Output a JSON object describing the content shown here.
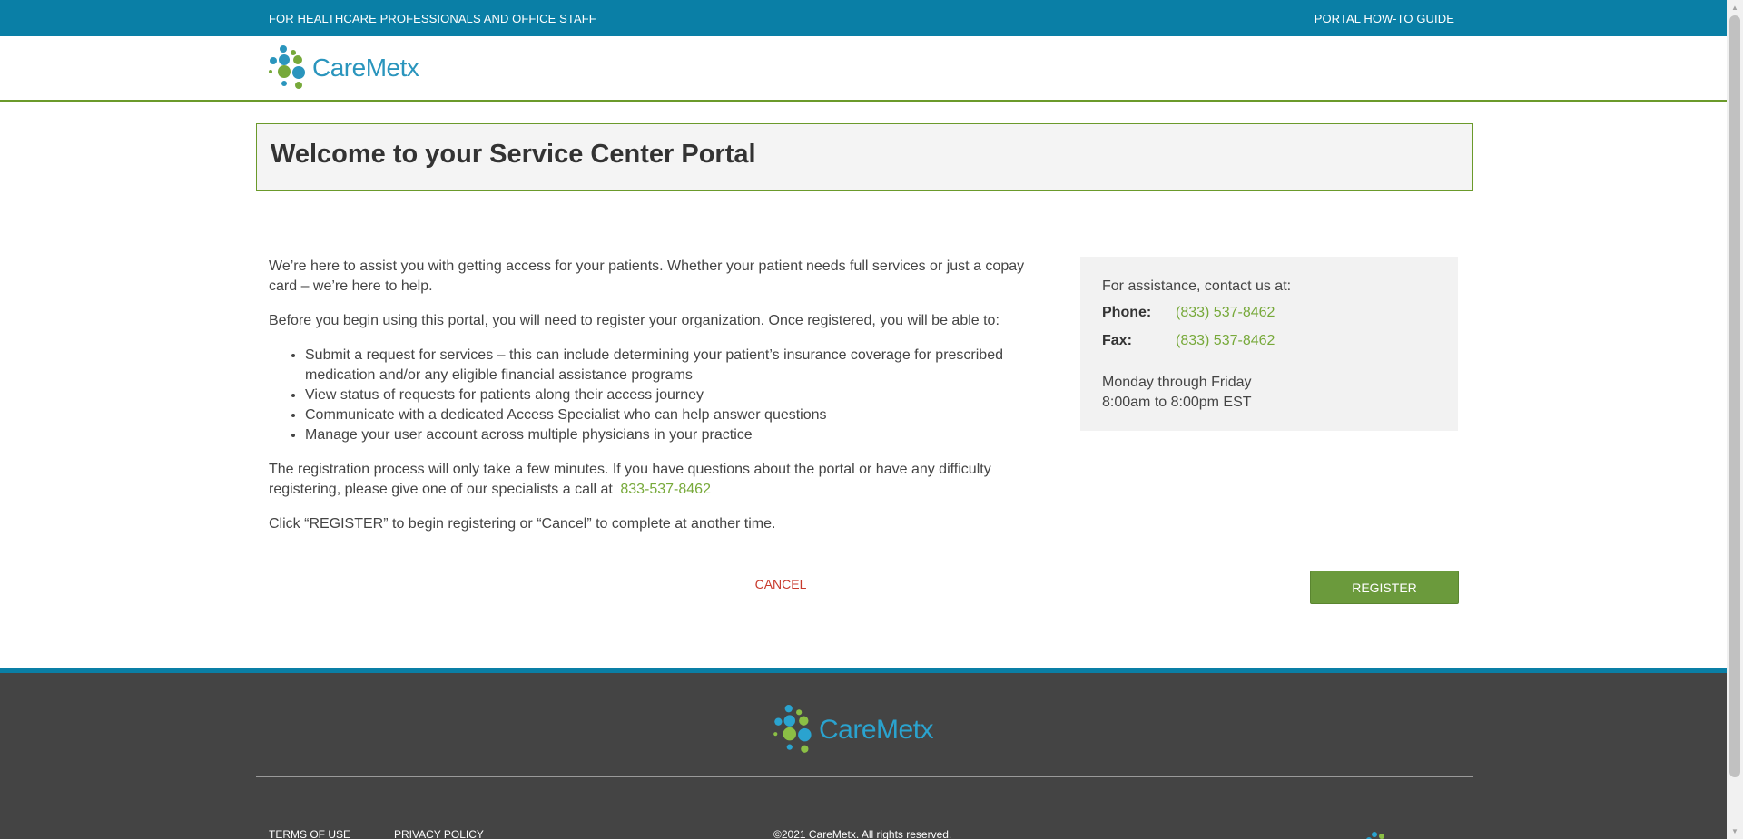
{
  "topbar": {
    "audience": "FOR HEALTHCARE PROFESSIONALS AND OFFICE STAFF",
    "guide_link": "PORTAL HOW-TO GUIDE"
  },
  "brand": {
    "logo_text": "CareMetx",
    "colors": {
      "teal": "#0a7fa6",
      "green": "#6b9a3c",
      "dark": "#444444"
    }
  },
  "welcome": {
    "title": "Welcome to your Service Center Portal"
  },
  "intro": {
    "p1": "We’re here to assist you with getting access for your patients. Whether your patient needs full services or just a copay card – we’re here to help.",
    "p2": "Before you begin using this portal, you will need to register your organization. Once registered, you will be able to:",
    "bullets": [
      "Submit a request for services – this can include determining your patient’s insurance coverage for prescribed medication and/or any eligible financial assistance programs",
      "View status of requests for patients along their access journey",
      "Communicate with a dedicated Access Specialist who can help answer questions",
      "Manage your user account across multiple physicians in your practice"
    ],
    "p3": "The registration process will only take a few minutes. If you have questions about the portal or have any difficulty registering, please give one of our specialists a call at",
    "p3_phone": "833-537-8462",
    "p4": "Click “REGISTER” to begin registering or “Cancel” to complete at another time."
  },
  "contact": {
    "heading": "For assistance, contact us at:",
    "phone_label": "Phone:",
    "phone": "(833) 537-8462",
    "fax_label": "Fax:",
    "fax": "(833) 537-8462",
    "days": "Monday through Friday",
    "hours": "8:00am to 8:00pm EST"
  },
  "actions": {
    "cancel": "CANCEL",
    "register": "REGISTER"
  },
  "footer": {
    "logo_text": "CareMetx",
    "terms": "TERMS OF USE",
    "privacy": "PRIVACY POLICY",
    "copyright": "©2021 CareMetx. All rights reserved."
  },
  "icons": {
    "logo_mark": "caremetx-dots-icon",
    "scroll_up": "scroll-up-arrow-icon",
    "scroll_down": "scroll-down-arrow-icon"
  }
}
